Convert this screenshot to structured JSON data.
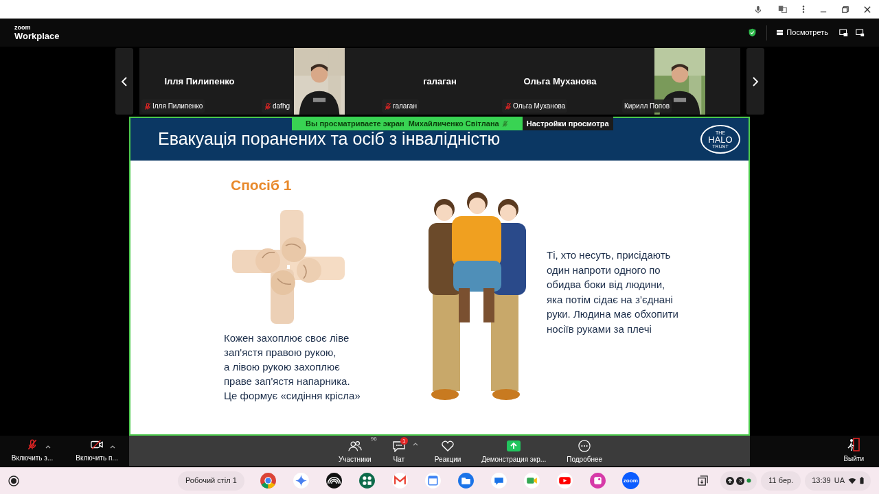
{
  "app_bar": {
    "logo_top": "zoom",
    "logo_bottom": "Workplace",
    "view_button": "Посмотреть"
  },
  "participants": [
    {
      "kind": "avatar",
      "name": "Ілля Пилипенко",
      "label": "Ілля Пилипенко",
      "muted": true
    },
    {
      "kind": "video",
      "label": "dafhg",
      "muted": true
    },
    {
      "kind": "avatar",
      "name": "галаган",
      "label": "галаган",
      "muted": true
    },
    {
      "kind": "avatar",
      "name": "Ольга Муханова",
      "label": "Ольга Муханова",
      "muted": true
    },
    {
      "kind": "video",
      "label": "Кирилл Попов",
      "muted": false
    }
  ],
  "share_banner": {
    "text": "Вы просматриваете экран  Михайличенко Світлана",
    "settings": "Настройки просмотра"
  },
  "slide": {
    "title": "Евакуація поранених та осіб з інвалідністю",
    "logo": {
      "top": "THE",
      "main": "HALO",
      "bottom": "TRUST"
    },
    "method": "Спосіб 1",
    "left_text": [
      "Кожен захоплює своє ліве",
      "зап'ястя правою рукою,",
      "а лівою рукою захоплює",
      "праве зап'ястя напарника.",
      "Це формує «сидіння крісла»"
    ],
    "right_text": [
      "Ті, хто несуть, присідають",
      "один напроти одного по",
      "обидва боки від людини,",
      "яка потім сідає на з’єднані",
      "руки. Людина має обхопити",
      "носіїв руками за плечі"
    ]
  },
  "toolbar": {
    "left": [
      {
        "kind": "mic",
        "label": "Включить з...",
        "muted": true
      },
      {
        "kind": "camera",
        "label": "Включить п...",
        "muted": true
      }
    ],
    "center": [
      {
        "kind": "participants",
        "label": "Участники",
        "count": "96"
      },
      {
        "kind": "chat",
        "label": "Чат",
        "badge": "1"
      },
      {
        "kind": "reactions",
        "label": "Реакции"
      },
      {
        "kind": "share",
        "label": "Демонстрация экр..."
      },
      {
        "kind": "more",
        "label": "Подробнее"
      }
    ],
    "leave": "Выйти"
  },
  "shelf": {
    "desk": "Робочий стіл 1",
    "zoom_label": "zoom",
    "notification_count": "3",
    "date": "11 бер.",
    "time": "13:39",
    "lang": "UA"
  }
}
